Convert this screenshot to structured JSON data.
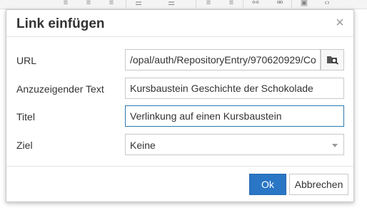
{
  "dialog": {
    "title": "Link einfügen",
    "close_glyph": "×",
    "fields": {
      "url": {
        "label": "URL",
        "value": "/opal/auth/RepositoryEntry/970620929/Co"
      },
      "text": {
        "label": "Anzuzeigender Text",
        "value": "Kursbaustein Geschichte der Schokolade"
      },
      "title": {
        "label": "Titel",
        "value": "Verlinkung auf einen Kursbaustein"
      },
      "target": {
        "label": "Ziel",
        "selected": "Keine"
      }
    },
    "buttons": {
      "ok": "Ok",
      "cancel": "Abbrechen"
    }
  },
  "toolbar": {
    "icons": [
      "align-left-icon",
      "align-center-icon",
      "align-right-icon",
      "bullet-list-icon",
      "numbered-list-icon",
      "outdent-icon",
      "indent-icon",
      "link-icon",
      "unlink-icon",
      "image-icon",
      "code-icon"
    ]
  },
  "colors": {
    "accent": "#2976c5",
    "focus_border": "#2a7ab0",
    "border": "#c9c9c9"
  }
}
